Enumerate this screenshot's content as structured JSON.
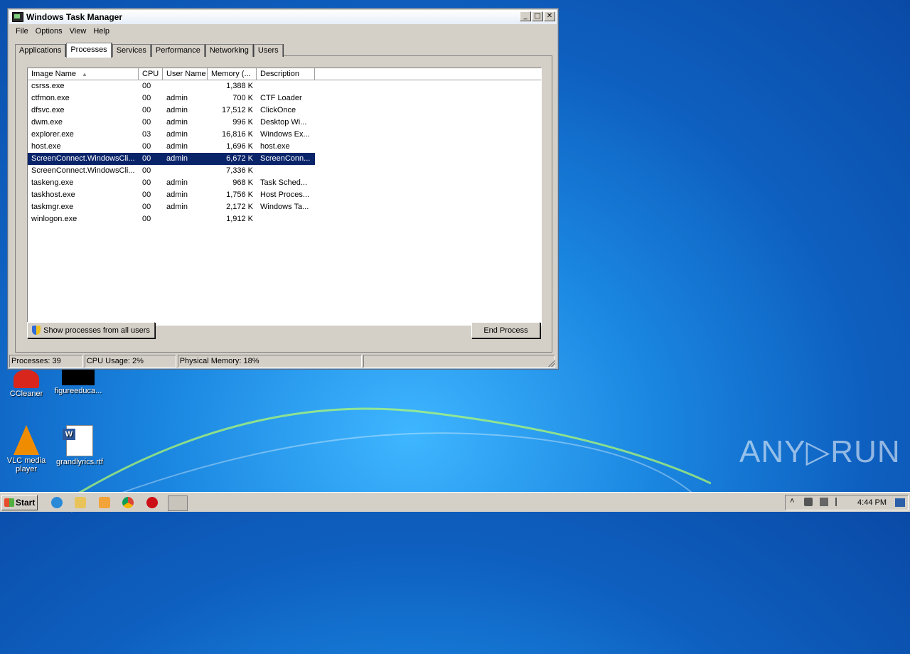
{
  "window": {
    "title": "Windows Task Manager",
    "buttons": [
      "_",
      "□",
      "✕"
    ]
  },
  "menu": [
    "File",
    "Options",
    "View",
    "Help"
  ],
  "tabs": [
    "Applications",
    "Processes",
    "Services",
    "Performance",
    "Networking",
    "Users"
  ],
  "active_tab": "Processes",
  "columns": [
    "Image Name",
    "CPU",
    "User Name",
    "Memory (...",
    "Description"
  ],
  "processes": [
    {
      "name": "csrss.exe",
      "cpu": "00",
      "user": "",
      "mem": "1,388 K",
      "desc": ""
    },
    {
      "name": "ctfmon.exe",
      "cpu": "00",
      "user": "admin",
      "mem": "700 K",
      "desc": "CTF Loader"
    },
    {
      "name": "dfsvc.exe",
      "cpu": "00",
      "user": "admin",
      "mem": "17,512 K",
      "desc": "ClickOnce"
    },
    {
      "name": "dwm.exe",
      "cpu": "00",
      "user": "admin",
      "mem": "996 K",
      "desc": "Desktop Wi..."
    },
    {
      "name": "explorer.exe",
      "cpu": "03",
      "user": "admin",
      "mem": "16,816 K",
      "desc": "Windows Ex..."
    },
    {
      "name": "host.exe",
      "cpu": "00",
      "user": "admin",
      "mem": "1,696 K",
      "desc": "host.exe"
    },
    {
      "name": "ScreenConnect.WindowsCli...",
      "cpu": "00",
      "user": "admin",
      "mem": "6,672 K",
      "desc": "ScreenConn...",
      "selected": true
    },
    {
      "name": "ScreenConnect.WindowsCli...",
      "cpu": "00",
      "user": "",
      "mem": "7,336 K",
      "desc": ""
    },
    {
      "name": "taskeng.exe",
      "cpu": "00",
      "user": "admin",
      "mem": "968 K",
      "desc": "Task Sched..."
    },
    {
      "name": "taskhost.exe",
      "cpu": "00",
      "user": "admin",
      "mem": "1,756 K",
      "desc": "Host Proces..."
    },
    {
      "name": "taskmgr.exe",
      "cpu": "00",
      "user": "admin",
      "mem": "2,172 K",
      "desc": "Windows Ta..."
    },
    {
      "name": "winlogon.exe",
      "cpu": "00",
      "user": "",
      "mem": "1,912 K",
      "desc": ""
    }
  ],
  "buttons": {
    "show_all": "Show processes from all users",
    "end_process": "End Process"
  },
  "status": {
    "processes": "Processes: 39",
    "cpu": "CPU Usage: 2%",
    "memory": "Physical Memory: 18%"
  },
  "desktop_icons": [
    {
      "label": "CCleaner"
    },
    {
      "label": "figureeduca..."
    },
    {
      "label": "VLC media player"
    },
    {
      "label": "grandlyrics.rtf"
    }
  ],
  "taskbar": {
    "start": "Start",
    "clock": "4:44 PM"
  },
  "watermark": "ANY▷RUN"
}
